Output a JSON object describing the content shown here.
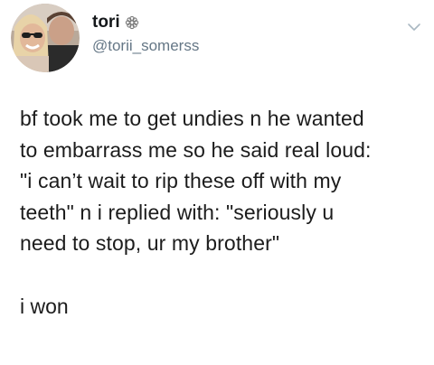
{
  "tweet": {
    "author": {
      "display_name": "tori",
      "name_emoji": "flower-emoji",
      "handle": "@torii_somerss"
    },
    "menu_icon": "chevron-down-icon",
    "body_lines": [
      "bf took me to get undies n he wanted",
      "to embarrass me so he said real loud:",
      "\"i can’t wait to rip these off with my",
      "teeth\" n i replied with: \"seriously u",
      "need to stop, ur my brother\""
    ],
    "closing_line": "i won"
  },
  "colors": {
    "text": "#1c1c1c",
    "handle": "#657786",
    "background": "#ffffff"
  }
}
